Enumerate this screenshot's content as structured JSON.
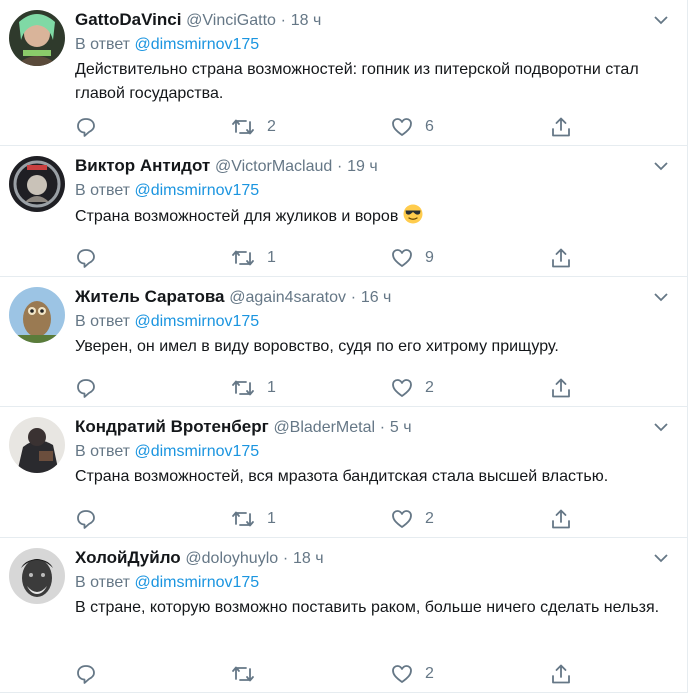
{
  "reply_prefix": "В ответ",
  "reply_to": "@dimsmirnov175",
  "dot": "·",
  "tweets": [
    {
      "name": "GattoDaVinci",
      "handle": "@VinciGatto",
      "time": "18 ч",
      "text": "Действительно страна возможностей: гопник из питерской подворотни стал главой государства.",
      "replies": "",
      "retweets": "2",
      "likes": "6"
    },
    {
      "name": "Виктор Антидот",
      "handle": "@VictorMaclaud",
      "time": "19 ч",
      "text": "Страна возможностей для жуликов и воров",
      "emoji": "sunglasses-emoji",
      "replies": "",
      "retweets": "1",
      "likes": "9"
    },
    {
      "name": "Житель Саратова",
      "handle": "@again4saratov",
      "time": "16 ч",
      "text": "Уверен, он имел в виду воровство, судя по его хитрому прищуру.",
      "replies": "",
      "retweets": "1",
      "likes": "2"
    },
    {
      "name": "Кондратий Вротенберг",
      "handle": "@BladerMetal",
      "time": "5 ч",
      "text": "Страна возможностей, вся мразота бандитская стала высшей властью.",
      "replies": "",
      "retweets": "1",
      "likes": "2"
    },
    {
      "name": "ХолойДуйло",
      "handle": "@doloyhuylo",
      "time": "18 ч",
      "text": "В стране, которую возможно поставить раком, больше ничего сделать нельзя.",
      "replies": "",
      "retweets": "",
      "likes": "2"
    }
  ],
  "colors": {
    "secondary_text": "#657786",
    "link": "#1b95e0",
    "primary_text": "#14171a",
    "border": "#e6ecf0"
  },
  "icons": [
    "reply-icon",
    "retweet-icon",
    "like-icon",
    "share-icon",
    "caret-down-icon"
  ]
}
